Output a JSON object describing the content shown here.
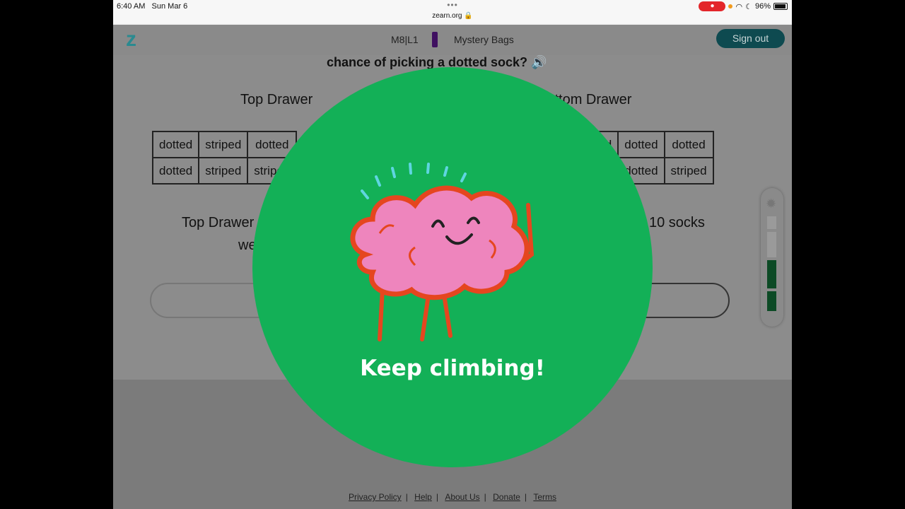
{
  "status": {
    "time": "6:40 AM",
    "date": "Sun Mar 6",
    "url": "zearn.org",
    "battery": "96%",
    "record_badge": "●"
  },
  "header": {
    "lesson": "M8|L1",
    "title": "Mystery Bags",
    "sign_out": "Sign out"
  },
  "question": "chance of picking a dotted sock?",
  "top_drawer": {
    "label": "Top Drawer",
    "rows": [
      [
        "dotted",
        "striped",
        "dotted"
      ],
      [
        "dotted",
        "striped",
        "striped"
      ]
    ],
    "caption": "Top Drawer",
    "caption2": "we"
  },
  "bottom_drawer": {
    "label": "Bottom Drawer",
    "rows": [
      [
        "dotted",
        "dotted",
        "dotted"
      ],
      [
        "dotted",
        "dotted",
        "striped"
      ]
    ],
    "caption": "10 socks"
  },
  "progress": {
    "filled": 2,
    "total": 4
  },
  "overlay": {
    "message": "Keep climbing!",
    "color": "#13b057"
  },
  "footer": {
    "links": [
      "Privacy Policy",
      "Help",
      "About Us",
      "Donate",
      "Terms"
    ]
  }
}
